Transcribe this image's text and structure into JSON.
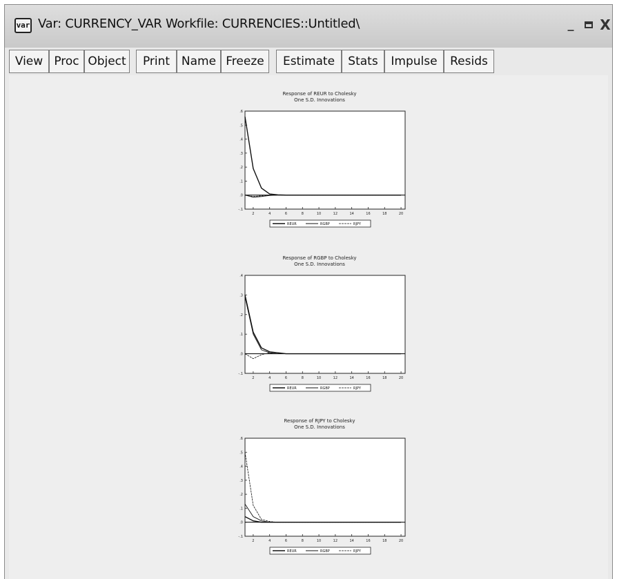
{
  "window": {
    "icon_text": "var",
    "title": "Var: CURRENCY_VAR   Workfile: CURRENCIES::Untitled\\",
    "minimize": "_",
    "close": "X"
  },
  "toolbar": {
    "buttons": [
      "View",
      "Proc",
      "Object",
      "Print",
      "Name",
      "Freeze",
      "Estimate",
      "Stats",
      "Impulse",
      "Resids"
    ]
  },
  "legend": [
    "REUR",
    "RGBP",
    "RJPY"
  ],
  "chart_data": [
    {
      "type": "line",
      "title": "Response of REUR to Cholesky",
      "subtitle": "One S.D. Innovations",
      "ylim": [
        -0.1,
        0.6
      ],
      "yticks": [
        ".6",
        ".5",
        ".4",
        ".3",
        ".2",
        ".1",
        ".0",
        "-.1"
      ],
      "xticks": [
        "2",
        "4",
        "6",
        "8",
        "10",
        "12",
        "14",
        "16",
        "18",
        "20"
      ],
      "x": [
        1,
        2,
        3,
        4,
        5,
        6,
        8,
        10,
        12,
        14,
        16,
        18,
        20
      ],
      "series": [
        {
          "name": "REUR",
          "values": [
            0.56,
            0.19,
            0.05,
            0.008,
            0.002,
            0.0,
            0.0,
            0.0,
            0.0,
            0.0,
            0.0,
            0.0,
            0.0
          ]
        },
        {
          "name": "RGBP",
          "values": [
            0.0,
            -0.015,
            -0.01,
            -0.003,
            0.0,
            0.0,
            0.0,
            0.0,
            0.0,
            0.0,
            0.0,
            0.0,
            0.0
          ]
        },
        {
          "name": "RJPY",
          "values": [
            0.0,
            -0.01,
            -0.005,
            0.0,
            0.0,
            0.0,
            0.0,
            0.0,
            0.0,
            0.0,
            0.0,
            0.0,
            0.0
          ]
        }
      ]
    },
    {
      "type": "line",
      "title": "Response of RGBP to Cholesky",
      "subtitle": "One S.D. Innovations",
      "ylim": [
        -0.1,
        0.4
      ],
      "yticks": [
        ".4",
        ".3",
        ".2",
        ".1",
        ".0",
        "-.1"
      ],
      "xticks": [
        "2",
        "4",
        "6",
        "8",
        "10",
        "12",
        "14",
        "16",
        "18",
        "20"
      ],
      "x": [
        1,
        2,
        3,
        4,
        5,
        6,
        8,
        10,
        12,
        14,
        16,
        18,
        20
      ],
      "series": [
        {
          "name": "REUR",
          "values": [
            0.3,
            0.11,
            0.03,
            0.01,
            0.005,
            0.0,
            0.0,
            0.0,
            0.0,
            0.0,
            0.0,
            0.0,
            0.0
          ]
        },
        {
          "name": "RGBP",
          "values": [
            0.29,
            0.1,
            0.02,
            0.005,
            0.0,
            0.0,
            0.0,
            0.0,
            0.0,
            0.0,
            0.0,
            0.0,
            0.0
          ]
        },
        {
          "name": "RJPY",
          "values": [
            0.0,
            -0.025,
            -0.005,
            0.005,
            0.0,
            0.0,
            0.0,
            0.0,
            0.0,
            0.0,
            0.0,
            0.0,
            0.0
          ]
        }
      ]
    },
    {
      "type": "line",
      "title": "Response of RJPY to Cholesky",
      "subtitle": "One S.D. Innovations",
      "ylim": [
        -0.1,
        0.6
      ],
      "yticks": [
        ".6",
        ".5",
        ".4",
        ".3",
        ".2",
        ".1",
        ".0",
        "-.1"
      ],
      "xticks": [
        "2",
        "4",
        "6",
        "8",
        "10",
        "12",
        "14",
        "16",
        "18",
        "20"
      ],
      "x": [
        1,
        2,
        3,
        4,
        5,
        6,
        8,
        10,
        12,
        14,
        16,
        18,
        20
      ],
      "series": [
        {
          "name": "REUR",
          "values": [
            0.04,
            0.01,
            0.0,
            0.0,
            0.0,
            0.0,
            0.0,
            0.0,
            0.0,
            0.0,
            0.0,
            0.0,
            0.0
          ]
        },
        {
          "name": "RGBP",
          "values": [
            0.13,
            0.04,
            0.01,
            0.0,
            0.0,
            0.0,
            0.0,
            0.0,
            0.0,
            0.0,
            0.0,
            0.0,
            0.0
          ]
        },
        {
          "name": "RJPY",
          "values": [
            0.5,
            0.12,
            0.02,
            0.005,
            0.0,
            0.0,
            0.0,
            0.0,
            0.0,
            0.0,
            0.0,
            0.0,
            0.0
          ]
        }
      ]
    }
  ]
}
